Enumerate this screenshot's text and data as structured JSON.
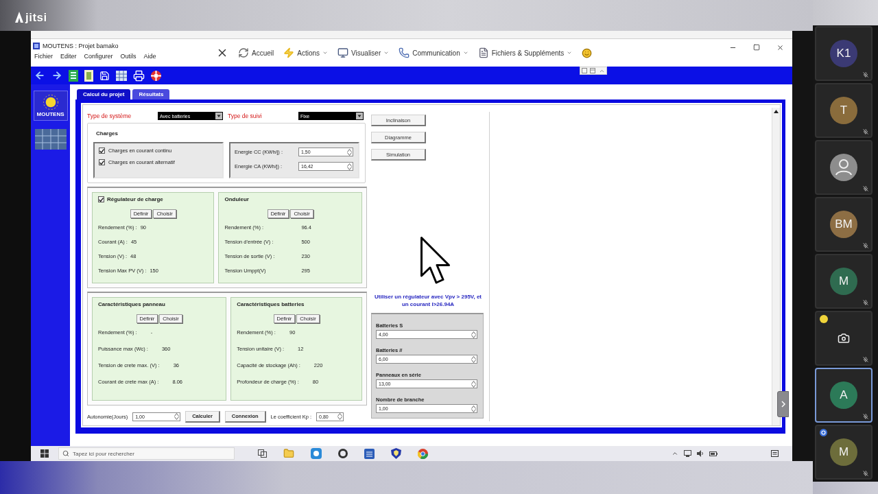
{
  "call": {
    "logo": "jitsi"
  },
  "app_window": {
    "title": "MOUTENS : Projet bamako",
    "menu": [
      "Fichier",
      "Editer",
      "Configurer",
      "Outils",
      "Aide"
    ],
    "ribbon": [
      {
        "label": "Accueil",
        "dropdown": false
      },
      {
        "label": "Actions",
        "dropdown": true
      },
      {
        "label": "Visualiser",
        "dropdown": true
      },
      {
        "label": "Communication",
        "dropdown": true
      },
      {
        "label": "Fichiers & Suppléments",
        "dropdown": true
      }
    ],
    "sidebar_logo": "MOUTENS",
    "tabs": [
      {
        "label": "Calcul du projet",
        "selected": true
      },
      {
        "label": "Résultats",
        "selected": false
      }
    ],
    "selectors": [
      {
        "label": "Type de système",
        "value": "Avec batteries"
      },
      {
        "label": "Type de suivi",
        "value": "Fixe"
      }
    ],
    "charges": {
      "title": "Charges",
      "options": [
        {
          "label": "Charges en courant continu",
          "checked": true
        },
        {
          "label": "Charges en courant alternatif",
          "checked": true
        }
      ],
      "fields": [
        {
          "label": "Energie CC (KWh/j) :",
          "value": "1,50"
        },
        {
          "label": "Energie CA (KWh/j) :",
          "value": "16,42"
        }
      ]
    },
    "groups": [
      [
        {
          "title": "Régulateur de charge",
          "kind": "check",
          "checked": true,
          "buttons": [
            "Définir",
            "Choisir"
          ],
          "rows": [
            {
              "label": "Rendement (%) :",
              "value": "90"
            },
            {
              "label": "Courant (A) :",
              "value": "45"
            },
            {
              "label": "Tension (V) :",
              "value": "48"
            },
            {
              "label": "Tension Max PV (V) :",
              "value": "150"
            }
          ]
        },
        {
          "title": "Onduleur",
          "kind": "plain",
          "buttons": [
            "Définir",
            "Choisir"
          ],
          "rows": [
            {
              "label": "Rendement (%) :",
              "value": "96.4"
            },
            {
              "label": "Tension d'entrée (V) :",
              "value": "500"
            },
            {
              "label": "Tension de sortie (V) :",
              "value": "230"
            },
            {
              "label": "Tension Umppt(V)",
              "value": "295"
            }
          ]
        }
      ],
      [
        {
          "title": "Caractéristiques panneau",
          "kind": "plain",
          "buttons": [
            "Définir",
            "Choisir"
          ],
          "rows": [
            {
              "label": "Rendement (%) :",
              "value": "-"
            },
            {
              "label": "Puissance max (Wc) :",
              "value": "360"
            },
            {
              "label": "Tension de crete max. (V) :",
              "value": "36"
            },
            {
              "label": "Courant de crete max (A) :",
              "value": "8.06"
            }
          ]
        },
        {
          "title": "Caractéristiques batteries",
          "kind": "plain",
          "buttons": [
            "Définir",
            "Choisir"
          ],
          "rows": [
            {
              "label": "Rendement (%) :",
              "value": "90"
            },
            {
              "label": "Tension unitaire (V) :",
              "value": "12"
            },
            {
              "label": "Capacité de stockage (Ah) :",
              "value": "220"
            },
            {
              "label": "Profondeur de charge (%) :",
              "value": "80"
            }
          ]
        }
      ]
    ],
    "actions": [
      "Inclinaison",
      "Diagramme",
      "Simulation"
    ],
    "advice": "Utiliser un régulateur avec Vpv > 295V, et un courant I>26.94A",
    "battery_config": [
      {
        "label": "Batteries S",
        "value": "4,00"
      },
      {
        "label": "Batteries //",
        "value": "6,00"
      },
      {
        "label": "Panneaux en série",
        "value": "13,00"
      },
      {
        "label": "Nombre de branche",
        "value": "1,00"
      }
    ],
    "footer": {
      "autonomy": {
        "label": "Autonomie(Jours)",
        "value": "1,00"
      },
      "buttons": [
        "Calculer",
        "Connexion"
      ],
      "kp": {
        "label": "Le coefficient Kp :",
        "value": "0,80"
      }
    }
  },
  "taskbar": {
    "search_placeholder": "Tapez ici pour rechercher"
  },
  "participants": [
    {
      "kind": "initials",
      "initials": "K1",
      "color": "#3b3a74",
      "selected": false,
      "muted": true,
      "status_dot": false,
      "info_badge": false
    },
    {
      "kind": "initials",
      "initials": "T",
      "color": "#8a6c3c",
      "selected": false,
      "muted": true,
      "status_dot": false,
      "info_badge": false
    },
    {
      "kind": "silhouette",
      "color": "#8d8d8d",
      "selected": false,
      "muted": true,
      "status_dot": false,
      "info_badge": false
    },
    {
      "kind": "initials",
      "initials": "BM",
      "color": "#8d6e44",
      "selected": false,
      "muted": true,
      "status_dot": false,
      "info_badge": false
    },
    {
      "kind": "initials",
      "initials": "M",
      "color": "#2f6b50",
      "selected": false,
      "muted": true,
      "status_dot": false,
      "info_badge": false
    },
    {
      "kind": "camera",
      "selected": false,
      "muted": true,
      "status_dot": true,
      "info_badge": false
    },
    {
      "kind": "initials",
      "initials": "A",
      "color": "#2c7a58",
      "selected": true,
      "muted": true,
      "status_dot": false,
      "info_badge": false
    },
    {
      "kind": "initials",
      "initials": "M",
      "color": "#6d6d3b",
      "selected": false,
      "muted": true,
      "status_dot": false,
      "info_badge": true
    }
  ]
}
